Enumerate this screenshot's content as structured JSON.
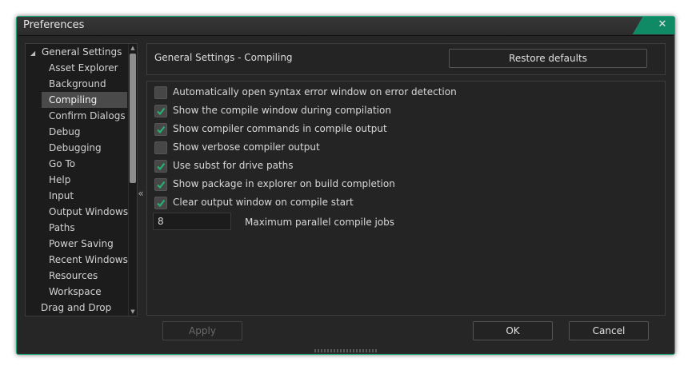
{
  "window": {
    "title": "Preferences"
  },
  "tree": {
    "root": "General Settings",
    "children": [
      "Asset Explorer",
      "Background",
      "Compiling",
      "Confirm Dialogs",
      "Debug",
      "Debugging",
      "Go To",
      "Help",
      "Input",
      "Output Windows",
      "Paths",
      "Power Saving",
      "Recent Windows",
      "Resources",
      "Workspace"
    ],
    "selected": "Compiling",
    "next_root": "Drag and Drop"
  },
  "section": {
    "title": "General Settings - Compiling",
    "restore_label": "Restore defaults"
  },
  "options": [
    {
      "label": "Automatically open syntax error window on error detection",
      "checked": false
    },
    {
      "label": "Show the compile window during compilation",
      "checked": true
    },
    {
      "label": "Show compiler commands in compile output",
      "checked": true
    },
    {
      "label": "Show verbose compiler output",
      "checked": false
    },
    {
      "label": "Use subst for drive paths",
      "checked": true
    },
    {
      "label": "Show package in explorer on build completion",
      "checked": true
    },
    {
      "label": "Clear output window on compile start",
      "checked": true
    }
  ],
  "parallel_jobs": {
    "value": "8",
    "label": "Maximum parallel compile jobs"
  },
  "footer": {
    "apply": "Apply",
    "ok": "OK",
    "cancel": "Cancel"
  },
  "colors": {
    "accent": "#1fa57e",
    "check": "#26b074"
  }
}
